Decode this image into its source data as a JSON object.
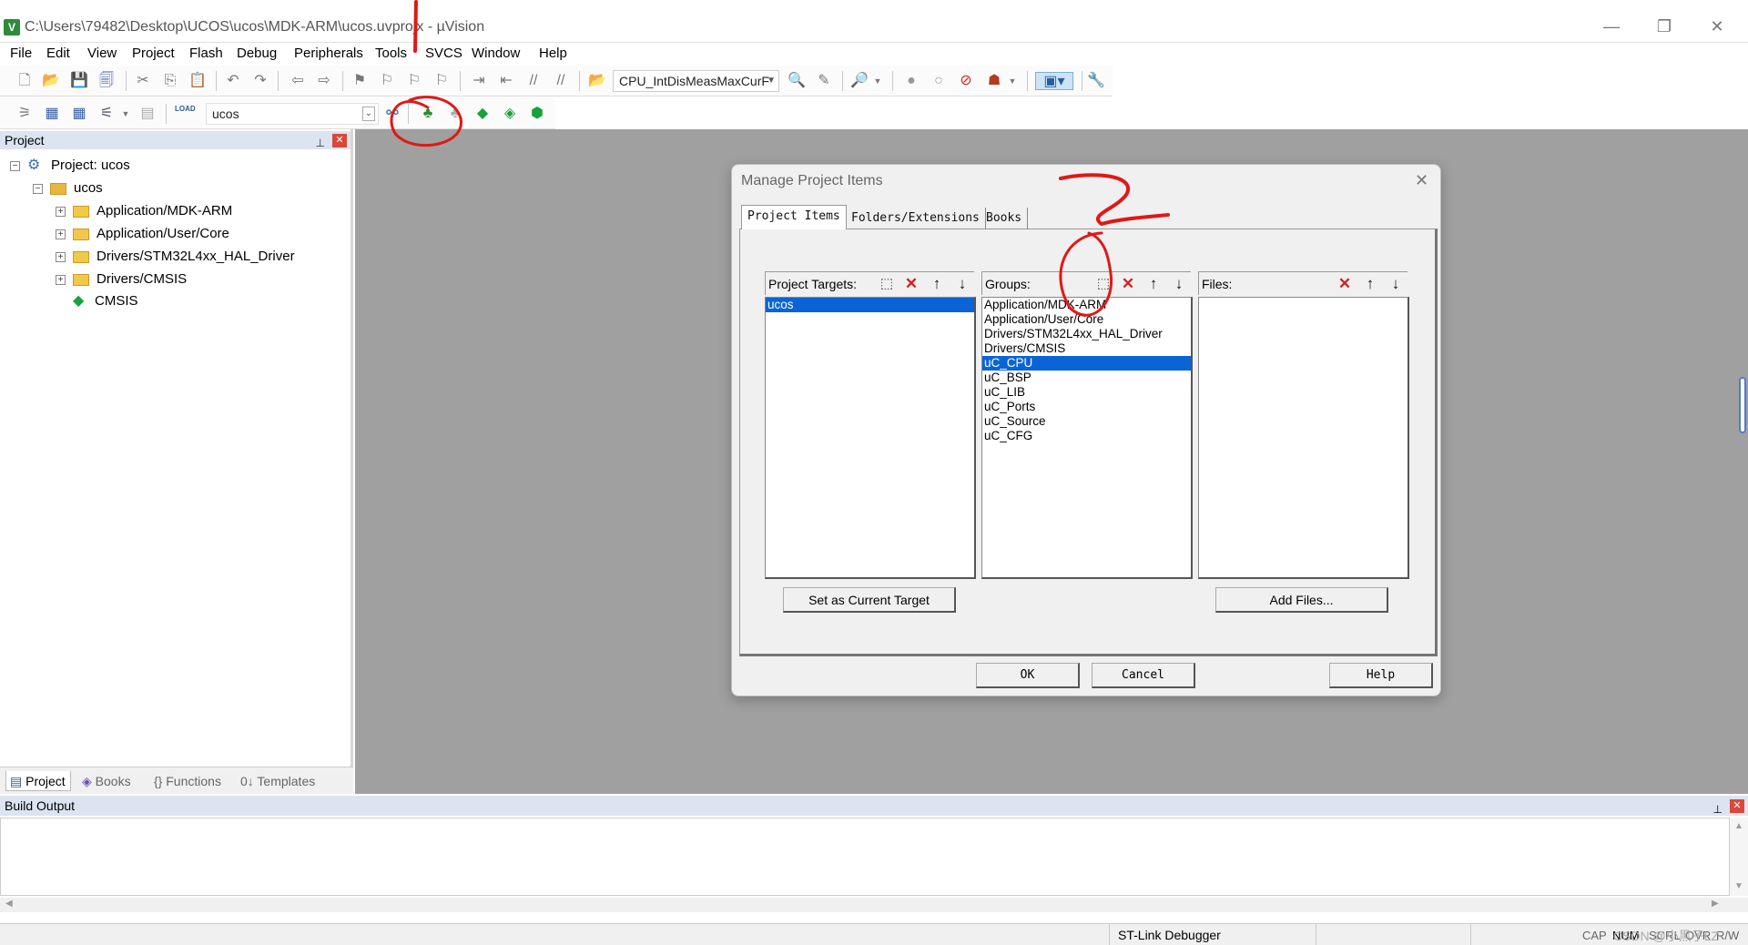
{
  "window": {
    "title": "C:\\Users\\79482\\Desktop\\UCOS\\ucos\\MDK-ARM\\ucos.uvprojx - µVision",
    "app_icon": "uv-icon",
    "minimize": "—",
    "maximize": "❐",
    "close": "✕"
  },
  "menu": {
    "items": [
      "File",
      "Edit",
      "View",
      "Project",
      "Flash",
      "Debug",
      "Peripherals",
      "Tools",
      "SVCS",
      "Window",
      "Help"
    ]
  },
  "toolbar": {
    "function_combo": "CPU_IntDisMeasMaxCurF",
    "target_combo": "ucos",
    "load_label": "LOAD"
  },
  "project_pane": {
    "header": "Project",
    "pin": "⊥",
    "close": "✕",
    "root": "Project: ucos",
    "target": "ucos",
    "groups": [
      "Application/MDK-ARM",
      "Application/User/Core",
      "Drivers/STM32L4xx_HAL_Driver",
      "Drivers/CMSIS",
      "CMSIS"
    ],
    "tabs": [
      "Project",
      "Books",
      "{} Functions",
      "0↓ Templates"
    ]
  },
  "dialog": {
    "title": "Manage Project Items",
    "close": "✕",
    "tabs": [
      "Project Items",
      "Folders/Extensions",
      "Books"
    ],
    "targets_label": "Project Targets:",
    "groups_label": "Groups:",
    "files_label": "Files:",
    "targets": [
      "ucos"
    ],
    "selected_target": "ucos",
    "groups": [
      "Application/MDK-ARM",
      "Application/User/Core",
      "Drivers/STM32L4xx_HAL_Driver",
      "Drivers/CMSIS",
      "uC_CPU",
      "uC_BSP",
      "uC_LIB",
      "uC_Ports",
      "uC_Source",
      "uC_CFG"
    ],
    "selected_group": "uC_CPU",
    "files": [],
    "set_target_button": "Set as Current Target",
    "add_files_button": "Add Files...",
    "ok_button": "OK",
    "cancel_button": "Cancel",
    "help_button": "Help"
  },
  "build_output": {
    "header": "Build Output"
  },
  "status": {
    "debugger": "ST-Link Debugger",
    "keys": [
      "CAP",
      "NUM",
      "SCRL",
      "OVR",
      "R/W"
    ],
    "watermark": "CSDN @小黑子LZ"
  },
  "colors": {
    "selection": "#0a64d6",
    "pane_header": "#dbe4f0",
    "workspace": "#a0a0a0",
    "annotation": "#e01818"
  }
}
